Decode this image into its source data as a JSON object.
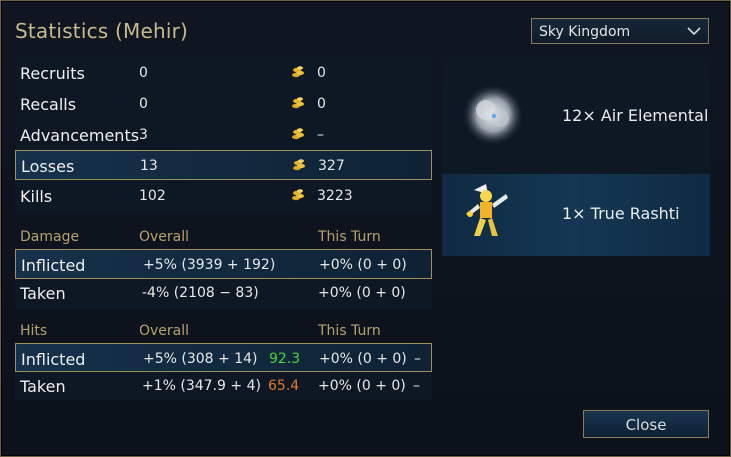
{
  "title": "Statistics (Mehir)",
  "scenario_select": {
    "value": "Sky Kingdom"
  },
  "summary": [
    {
      "label": "Recruits",
      "count": "0",
      "gold": "0"
    },
    {
      "label": "Recalls",
      "count": "0",
      "gold": "0"
    },
    {
      "label": "Advancements",
      "count": "3",
      "gold": "–"
    },
    {
      "label": "Losses",
      "count": "13",
      "gold": "327"
    },
    {
      "label": "Kills",
      "count": "102",
      "gold": "3223"
    }
  ],
  "damage": {
    "header": {
      "label": "Damage",
      "overall": "Overall",
      "this_turn": "This Turn"
    },
    "rows": [
      {
        "label": "Inflicted",
        "overall": "+5% (3939 + 192)",
        "this_turn": "+0% (0 + 0)"
      },
      {
        "label": "Taken",
        "overall": "-4% (2108 − 83)",
        "this_turn": "+0% (0 + 0)"
      }
    ]
  },
  "hits": {
    "header": {
      "label": "Hits",
      "overall": "Overall",
      "this_turn": "This Turn"
    },
    "rows": [
      {
        "label": "Inflicted",
        "overall": "+5% (308 + 14)",
        "rating": "92.3",
        "this_turn": "+0% (0 + 0)",
        "extra": "–"
      },
      {
        "label": "Taken",
        "overall": "+1% (347.9 + 4)",
        "rating": "65.4",
        "this_turn": "+0% (0 + 0)",
        "extra": "–"
      }
    ]
  },
  "units": [
    {
      "label": "12× Air Elemental",
      "icon": "air-elemental-icon"
    },
    {
      "label": "1× True Rashti",
      "icon": "true-rashti-icon"
    }
  ],
  "close_label": "Close",
  "colors": {
    "gold_border": "#a08f5e",
    "title": "#c9ba8c",
    "header": "#b7a06a",
    "good": "#49d33a",
    "bad": "#e0782a"
  }
}
